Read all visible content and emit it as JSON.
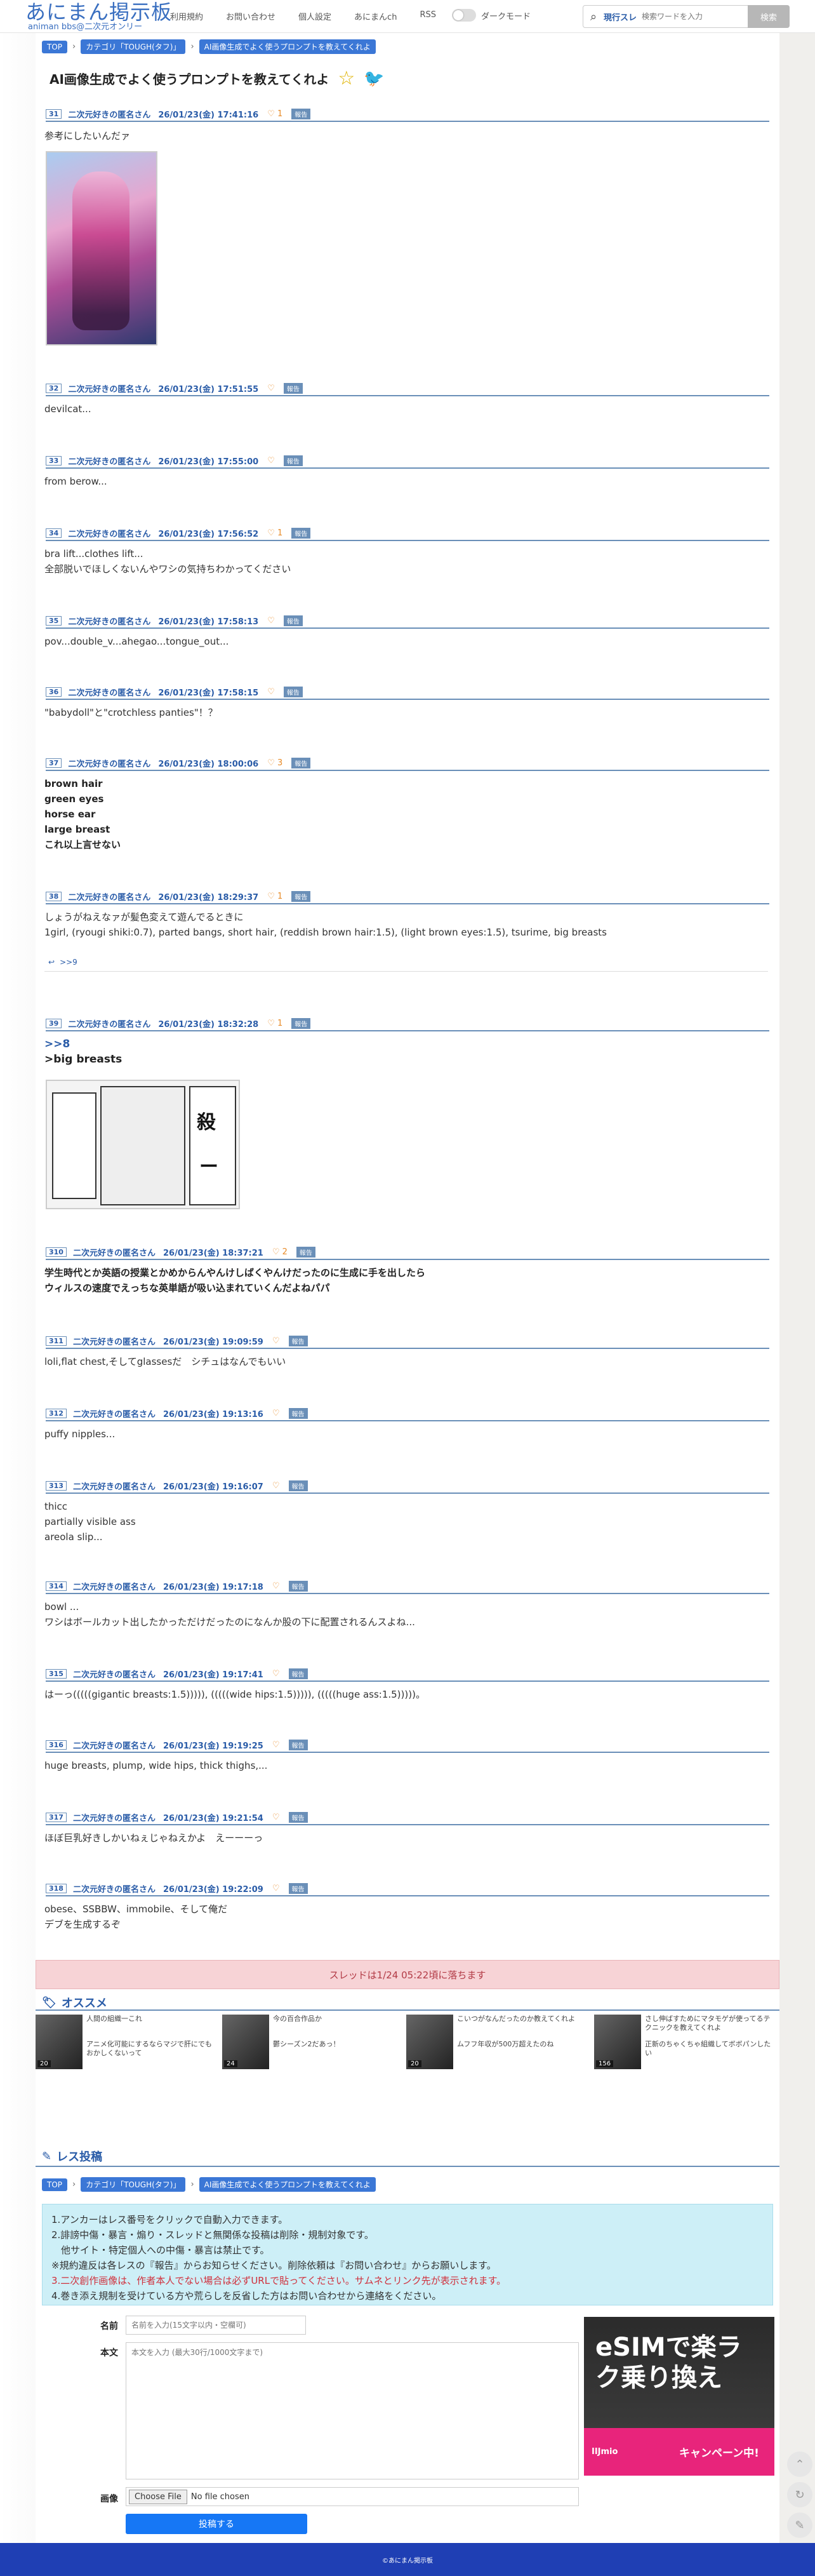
{
  "header": {
    "logo_title": "あにまん掲示板",
    "logo_sub": "animan bbs@二次元オンリー",
    "nav": [
      "利用規約",
      "お問い合わせ",
      "個人設定",
      "あにまんch",
      "RSS"
    ],
    "dark_mode_label": "ダークモード",
    "search_scope": "現行スレ",
    "search_placeholder": "検索ワードを入力",
    "search_button": "検索"
  },
  "breadcrumb": [
    "TOP",
    "カテゴリ「TOUGH(タフ)」",
    "AI画像生成でよく使うプロンプトを教えてくれよ"
  ],
  "thread_title": "AI画像生成でよく使うプロンプトを教えてくれよ",
  "poster_name": "二次元好きの匿名さん",
  "report_label": "報告",
  "posts": [
    {
      "no": "31",
      "date": "26/01/23(金) 17:41:16",
      "likes": "1",
      "lines": [
        "参考にしたいんだァ"
      ]
    },
    {
      "no": "32",
      "date": "26/01/23(金) 17:51:55",
      "likes": "",
      "lines": [
        "devilcat..."
      ]
    },
    {
      "no": "33",
      "date": "26/01/23(金) 17:55:00",
      "likes": "",
      "lines": [
        "from berow..."
      ]
    },
    {
      "no": "34",
      "date": "26/01/23(金) 17:56:52",
      "likes": "1",
      "lines": [
        "bra lift...clothes lift...",
        "全部脱いでほしくないんやワシの気持ちわかってください"
      ]
    },
    {
      "no": "35",
      "date": "26/01/23(金) 17:58:13",
      "likes": "",
      "lines": [
        "pov...double_v...ahegao...tongue_out..."
      ]
    },
    {
      "no": "36",
      "date": "26/01/23(金) 17:58:15",
      "likes": "",
      "lines": [
        "\"babydoll\"と\"crotchless panties\"！？"
      ]
    },
    {
      "no": "37",
      "date": "26/01/23(金) 18:00:06",
      "likes": "3",
      "lines": [
        "brown hair",
        "green eyes",
        "horse ear",
        "large breast",
        "これ以上言せない"
      ]
    },
    {
      "no": "38",
      "date": "26/01/23(金) 18:29:37",
      "likes": "1",
      "lines": [
        "しょうがねえなァが髪色変えて遊んでるときに",
        "1girl, (ryougi shiki:0.7), parted bangs, short hair, (reddish brown hair:1.5), (light brown eyes:1.5), tsurime, big breasts"
      ]
    },
    {
      "no": "39",
      "date": "26/01/23(金) 18:32:28",
      "likes": "1",
      "lines": [
        ">>8",
        ">big breasts"
      ]
    },
    {
      "no": "310",
      "date": "26/01/23(金) 18:37:21",
      "likes": "2",
      "lines": [
        "学生時代とか英語の授業とかめからんやんけしばくやんけだったのに生成に手を出したら",
        "ウィルスの速度でえっちな英単語が吸い込まれていくんだよねパパ"
      ]
    },
    {
      "no": "311",
      "date": "26/01/23(金) 19:09:59",
      "likes": "",
      "lines": [
        "loli,flat chest,そしてglassesだ　シチュはなんでもいい"
      ]
    },
    {
      "no": "312",
      "date": "26/01/23(金) 19:13:16",
      "likes": "",
      "lines": [
        "puffy nipples..."
      ]
    },
    {
      "no": "313",
      "date": "26/01/23(金) 19:16:07",
      "likes": "",
      "lines": [
        "thicc",
        "partially visible ass",
        "areola slip..."
      ]
    },
    {
      "no": "314",
      "date": "26/01/23(金) 19:17:18",
      "likes": "",
      "lines": [
        "bowl ...",
        "ワシはボールカット出したかっただけだったのになんか股の下に配置されるんスよね..."
      ]
    },
    {
      "no": "315",
      "date": "26/01/23(金) 19:17:41",
      "likes": "",
      "lines": [
        "はーっ(((((gigantic breasts:1.5))))), (((((wide hips:1.5))))), (((((huge ass:1.5)))))。"
      ]
    },
    {
      "no": "316",
      "date": "26/01/23(金) 19:19:25",
      "likes": "",
      "lines": [
        "huge breasts, plump, wide hips, thick thighs,..."
      ]
    },
    {
      "no": "317",
      "date": "26/01/23(金) 19:21:54",
      "likes": "",
      "lines": [
        "ほぼ巨乳好きしかいねぇじゃねえかよ　えーーーっ"
      ]
    },
    {
      "no": "318",
      "date": "26/01/23(金) 19:22:09",
      "likes": "",
      "lines": [
        "obese、SSBBW、immobile、そして俺だ",
        "デブを生成するぞ"
      ]
    }
  ],
  "more_link": ">>9",
  "dead_notice": "スレッドは1/24 05:22頃に落ちます",
  "recommend_title": "オススメ",
  "recommend": [
    {
      "t1": "人間の組織一これ",
      "t2": "アニメ化可能にするならマジで肝にでもおかしくないって",
      "count": "20"
    },
    {
      "t1": "今の百合作品か",
      "t2": "鬱シーズン2だあっ！",
      "count": "24"
    },
    {
      "t1": "こいつがなんだったのか教えてくれよ",
      "t2": "ムフフ年収が500万超えたのね",
      "count": "20"
    },
    {
      "t1": "さし伸ばすためにマタモゲが使ってるテクニックを教えてくれよ",
      "t2": "正新のちゃくちゃ組織してボボパンしたい",
      "count": "156"
    }
  ],
  "reply_title": "レス投稿",
  "rules": [
    "1.アンカーはレス番号をクリックで自動入力できます。",
    "2.誹謗中傷・暴言・煽り・スレッドと無関係な投稿は削除・規制対象です。",
    "　他サイト・特定個人への中傷・暴言は禁止です。",
    "※規約違反は各レスの『報告』からお知らせください。削除依頼は『お問い合わせ』からお願いします。",
    "3.二次創作画像は、作者本人でない場合は必ずURLで貼ってください。サムネとリンク先が表示されます。",
    "4.巻き添え規制を受けている方や荒らしを反省した方はお問い合わせから連絡をください。"
  ],
  "form": {
    "name_label": "名前",
    "name_placeholder": "名前を入力(15文字以内・空欄可)",
    "body_label": "本文",
    "body_placeholder": "本文を入力 (最大30行/1000文字まで)",
    "image_label": "画像",
    "file_button": "Choose File",
    "file_status": "No file chosen",
    "submit": "投稿する"
  },
  "ad": {
    "t1": "eSIMで楽ラク乗り換え",
    "brand": "IIJmio",
    "cta": "キャンペーン中!"
  },
  "footer": "©あにまん掲示板",
  "colors": {
    "accent": "#2a5ca8",
    "badge": "#3b77d6",
    "footer": "#1f3fb4",
    "heart": "#e88b28"
  }
}
